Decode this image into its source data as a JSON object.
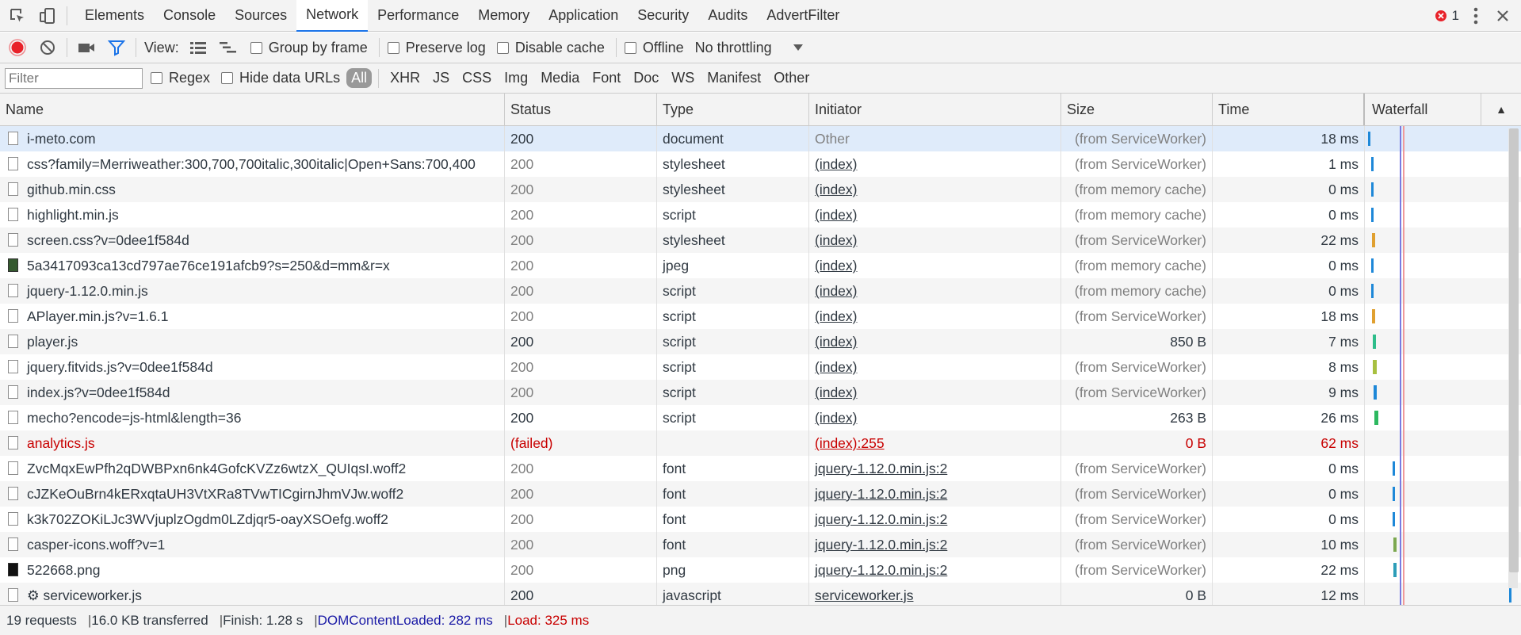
{
  "tabs": {
    "items": [
      "Elements",
      "Console",
      "Sources",
      "Network",
      "Performance",
      "Memory",
      "Application",
      "Security",
      "Audits",
      "AdvertFilter"
    ],
    "active": "Network",
    "error_count": "1"
  },
  "toolbar": {
    "view_label": "View:",
    "group_by_frame": "Group by frame",
    "preserve_log": "Preserve log",
    "disable_cache": "Disable cache",
    "offline": "Offline",
    "throttling": "No throttling"
  },
  "filter": {
    "placeholder": "Filter",
    "regex": "Regex",
    "hide_data_urls": "Hide data URLs",
    "types": [
      "All",
      "XHR",
      "JS",
      "CSS",
      "Img",
      "Media",
      "Font",
      "Doc",
      "WS",
      "Manifest",
      "Other"
    ],
    "active_type": "All"
  },
  "columns": {
    "name": "Name",
    "status": "Status",
    "type": "Type",
    "initiator": "Initiator",
    "size": "Size",
    "time": "Time",
    "waterfall": "Waterfall",
    "sort_indicator": "▲"
  },
  "rows": [
    {
      "name": "i-meto.com",
      "status": "200",
      "type": "document",
      "initiator": "Other",
      "size": "(from ServiceWorker)",
      "time": "18 ms",
      "icon": "document-icon"
    },
    {
      "name": "css?family=Merriweather:300,700,700italic,300italic|Open+Sans:700,400",
      "status": "200",
      "type": "stylesheet",
      "initiator": "(index)",
      "size": "(from ServiceWorker)",
      "time": "1 ms",
      "icon": "document-icon"
    },
    {
      "name": "github.min.css",
      "status": "200",
      "type": "stylesheet",
      "initiator": "(index)",
      "size": "(from memory cache)",
      "time": "0 ms",
      "icon": "document-icon"
    },
    {
      "name": "highlight.min.js",
      "status": "200",
      "type": "script",
      "initiator": "(index)",
      "size": "(from memory cache)",
      "time": "0 ms",
      "icon": "document-icon"
    },
    {
      "name": "screen.css?v=0dee1f584d",
      "status": "200",
      "type": "stylesheet",
      "initiator": "(index)",
      "size": "(from ServiceWorker)",
      "time": "22 ms",
      "icon": "document-icon"
    },
    {
      "name": "5a3417093ca13cd797ae76ce191afcb9?s=250&d=mm&r=x",
      "status": "200",
      "type": "jpeg",
      "initiator": "(index)",
      "size": "(from memory cache)",
      "time": "0 ms",
      "icon": "image-icon"
    },
    {
      "name": "jquery-1.12.0.min.js",
      "status": "200",
      "type": "script",
      "initiator": "(index)",
      "size": "(from memory cache)",
      "time": "0 ms",
      "icon": "document-icon"
    },
    {
      "name": "APlayer.min.js?v=1.6.1",
      "status": "200",
      "type": "script",
      "initiator": "(index)",
      "size": "(from ServiceWorker)",
      "time": "18 ms",
      "icon": "document-icon"
    },
    {
      "name": "player.js",
      "status": "200",
      "type": "script",
      "initiator": "(index)",
      "size": "850 B",
      "time": "7 ms",
      "icon": "document-icon"
    },
    {
      "name": "jquery.fitvids.js?v=0dee1f584d",
      "status": "200",
      "type": "script",
      "initiator": "(index)",
      "size": "(from ServiceWorker)",
      "time": "8 ms",
      "icon": "document-icon"
    },
    {
      "name": "index.js?v=0dee1f584d",
      "status": "200",
      "type": "script",
      "initiator": "(index)",
      "size": "(from ServiceWorker)",
      "time": "9 ms",
      "icon": "document-icon"
    },
    {
      "name": "mecho?encode=js-html&length=36",
      "status": "200",
      "type": "script",
      "initiator": "(index)",
      "size": "263 B",
      "time": "26 ms",
      "icon": "document-icon"
    },
    {
      "name": "analytics.js",
      "status": "(failed)",
      "type": "",
      "initiator": "(index):255",
      "size": "0 B",
      "time": "62 ms",
      "icon": "document-icon",
      "failed": true
    },
    {
      "name": "ZvcMqxEwPfh2qDWBPxn6nk4GofcKVZz6wtzX_QUIqsI.woff2",
      "status": "200",
      "type": "font",
      "initiator": "jquery-1.12.0.min.js:2",
      "size": "(from ServiceWorker)",
      "time": "0 ms",
      "icon": "document-icon"
    },
    {
      "name": "cJZKeOuBrn4kERxqtaUH3VtXRa8TVwTICgirnJhmVJw.woff2",
      "status": "200",
      "type": "font",
      "initiator": "jquery-1.12.0.min.js:2",
      "size": "(from ServiceWorker)",
      "time": "0 ms",
      "icon": "document-icon"
    },
    {
      "name": "k3k702ZOKiLJc3WVjuplzOgdm0LZdjqr5-oayXSOefg.woff2",
      "status": "200",
      "type": "font",
      "initiator": "jquery-1.12.0.min.js:2",
      "size": "(from ServiceWorker)",
      "time": "0 ms",
      "icon": "document-icon"
    },
    {
      "name": "casper-icons.woff?v=1",
      "status": "200",
      "type": "font",
      "initiator": "jquery-1.12.0.min.js:2",
      "size": "(from ServiceWorker)",
      "time": "10 ms",
      "icon": "document-icon"
    },
    {
      "name": "522668.png",
      "status": "200",
      "type": "png",
      "initiator": "jquery-1.12.0.min.js:2",
      "size": "(from ServiceWorker)",
      "time": "22 ms",
      "icon": "png-icon"
    },
    {
      "name": "⚙ serviceworker.js",
      "status": "200",
      "type": "javascript",
      "initiator": "serviceworker.js",
      "size": "0 B",
      "time": "12 ms",
      "icon": "document-icon"
    }
  ],
  "status_bar": {
    "requests": "19 requests",
    "transferred": "16.0 KB transferred",
    "finish": "Finish: 1.28 s",
    "dom_content_loaded": "DOMContentLoaded: 282 ms",
    "load": "Load: 325 ms"
  },
  "colors": {
    "record": "#e8222a",
    "filter_active": "#1a73e8",
    "dom_content_loaded": "#1a1aa6",
    "load": "#c80000",
    "failed": "#c80000"
  }
}
